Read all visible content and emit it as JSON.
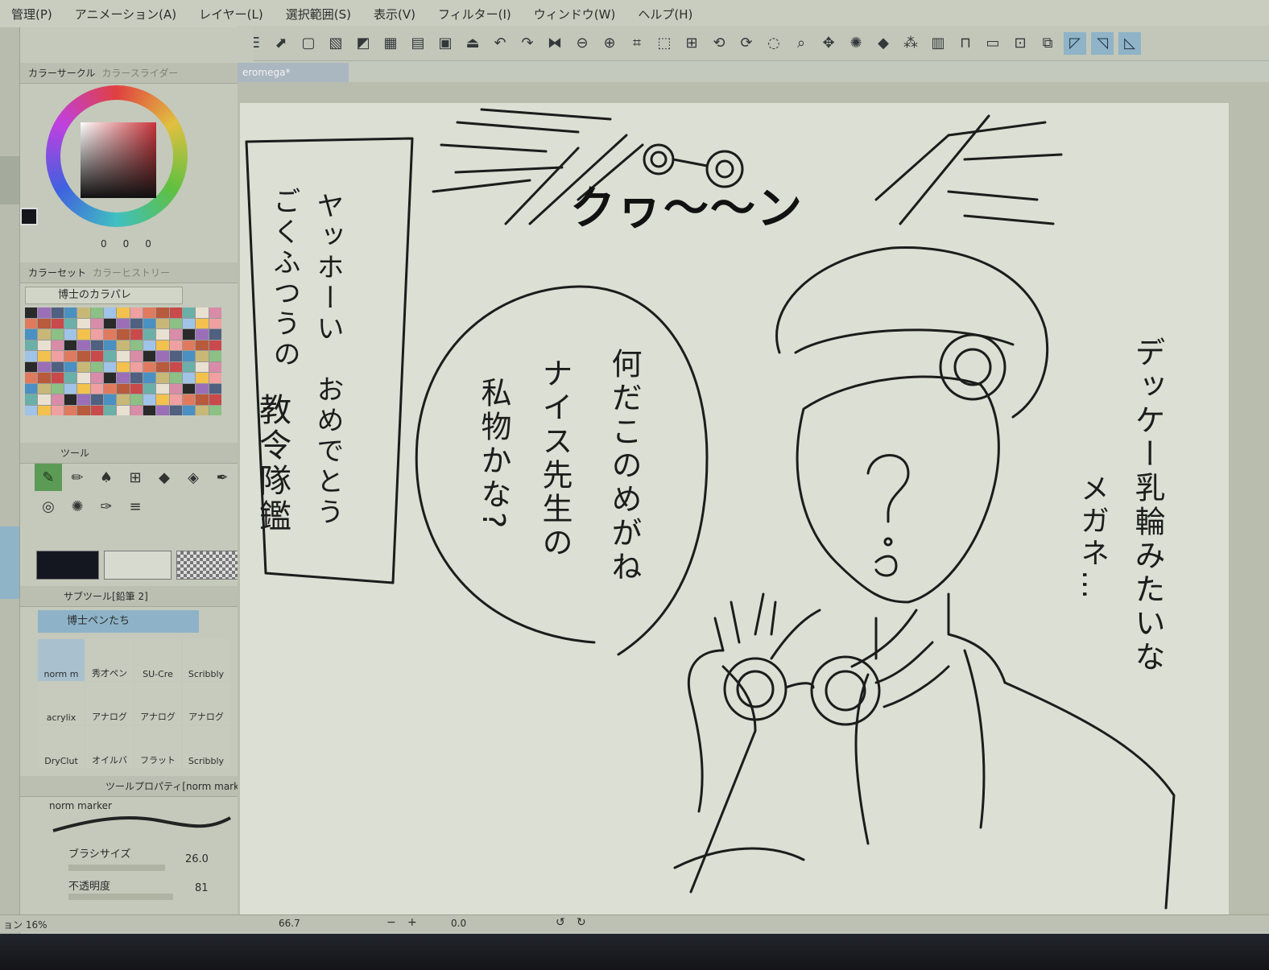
{
  "menu": [
    "管理(P)",
    "アニメーション(A)",
    "レイヤー(L)",
    "選択範囲(S)",
    "表示(V)",
    "フィルター(I)",
    "ウィンドウ(W)",
    "ヘルプ(H)"
  ],
  "document_tab": "eromega*",
  "color_panel": {
    "tab_circle": "カラーサークル",
    "tab_slider": "カラースライダー",
    "values": [
      "0",
      "0",
      "0"
    ]
  },
  "colorset_panel": {
    "tab_set": "カラーセット",
    "tab_history": "カラーヒストリー",
    "selected_set": "博士のカラパレ"
  },
  "tool_panel": {
    "tab": "ツール"
  },
  "subtool_panel": {
    "tab": "サブツール[鉛筆 2]",
    "group": "博士ペンたち",
    "brushes": [
      "norm m",
      "秀才ペン",
      "SU-Cre",
      "Scribbly",
      "acrylix",
      "アナログ",
      "アナログ",
      "アナログ",
      "DryClut",
      "オイルバ",
      "フラット",
      "Scribbly"
    ]
  },
  "property_panel": {
    "tab": "ツールプロパティ[norm marke",
    "brush_name": "norm marker",
    "brush_size_label": "ブラシサイズ",
    "brush_size_value": "26.0",
    "opacity_label": "不透明度",
    "opacity_value": "81"
  },
  "status": {
    "zoom_left": "ョン 16%",
    "zoom": "66.7",
    "angle": "0.0"
  },
  "artwork": {
    "sfx": "クヮ〜〜ン",
    "box_text": [
      "ヤッホーい　おめでとう",
      "ごくふつうの",
      "教令隊鑑"
    ],
    "bubble_text": [
      "何だこのめがね",
      "ナイス先生の",
      "私物かな?"
    ],
    "side_text": [
      "デッケー乳輪みたいな",
      "メガネ…"
    ],
    "face_mark": "?"
  }
}
